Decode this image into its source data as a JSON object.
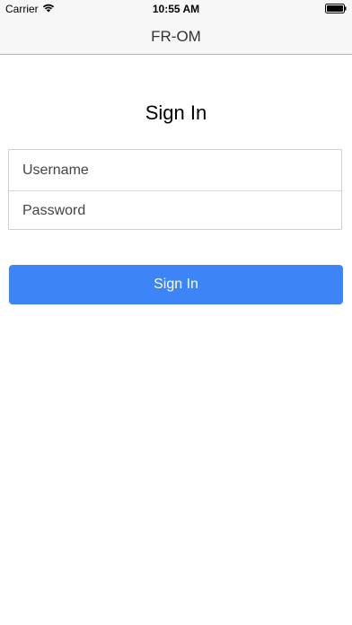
{
  "status_bar": {
    "carrier": "Carrier",
    "time": "10:55 AM",
    "wifi_icon": "wifi-icon",
    "battery_icon": "battery-icon"
  },
  "nav": {
    "title": "FR-OM"
  },
  "page": {
    "title": "Sign In"
  },
  "form": {
    "username": {
      "placeholder": "Username",
      "value": ""
    },
    "password": {
      "placeholder": "Password",
      "value": ""
    },
    "submit_label": "Sign In"
  },
  "colors": {
    "primary": "#3d85f6",
    "nav_background": "#f7f7f7"
  }
}
